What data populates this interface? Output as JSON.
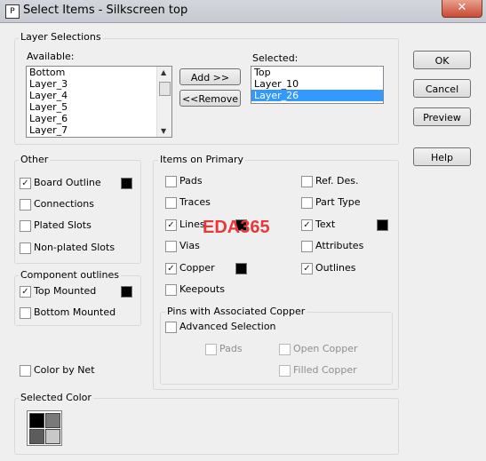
{
  "window": {
    "title": "Select Items - Silkscreen top",
    "close_glyph": "✕",
    "icon_glyph": "P"
  },
  "layer_selections": {
    "label": "Layer Selections",
    "available_label": "Available:",
    "available_items": [
      "Bottom",
      "Layer_3",
      "Layer_4",
      "Layer_5",
      "Layer_6",
      "Layer_7"
    ],
    "selected_label": "Selected:",
    "selected_items": [
      "Top",
      "Layer_10",
      "Layer_26"
    ],
    "selected_highlight_index": 2,
    "add_label": "Add >>",
    "remove_label": "<<Remove"
  },
  "buttons": {
    "ok": "OK",
    "cancel": "Cancel",
    "preview": "Preview",
    "help": "Help"
  },
  "other": {
    "label": "Other",
    "items": [
      {
        "label": "Board Outline",
        "checked": true,
        "color": "#000000"
      },
      {
        "label": "Connections",
        "checked": false
      },
      {
        "label": "Plated Slots",
        "checked": false
      },
      {
        "label": "Non-plated Slots",
        "checked": false
      }
    ]
  },
  "component_outlines": {
    "label": "Component outlines",
    "items": [
      {
        "label": "Top Mounted",
        "checked": true,
        "color": "#000000"
      },
      {
        "label": "Bottom Mounted",
        "checked": false
      }
    ]
  },
  "color_by_net": {
    "label": "Color by Net",
    "checked": false
  },
  "items_on_primary": {
    "label": "Items on Primary",
    "left": [
      {
        "label": "Pads",
        "checked": false
      },
      {
        "label": "Traces",
        "checked": false
      },
      {
        "label": "Lines",
        "checked": true,
        "color": "#000000"
      },
      {
        "label": "Vias",
        "checked": false
      },
      {
        "label": "Copper",
        "checked": true,
        "color": "#000000"
      },
      {
        "label": "Keepouts",
        "checked": false
      }
    ],
    "right": [
      {
        "label": "Ref. Des.",
        "checked": false
      },
      {
        "label": "Part Type",
        "checked": false
      },
      {
        "label": "Text",
        "checked": true,
        "color": "#000000"
      },
      {
        "label": "Attributes",
        "checked": false
      },
      {
        "label": "Outlines",
        "checked": true
      }
    ]
  },
  "pins": {
    "label": "Pins with Associated Copper",
    "advanced": {
      "label": "Advanced Selection",
      "checked": false
    },
    "pads": {
      "label": "Pads",
      "checked": false
    },
    "open_copper": {
      "label": "Open Copper",
      "checked": false
    },
    "filled_copper": {
      "label": "Filled Copper",
      "checked": false
    }
  },
  "selected_color": {
    "label": "Selected Color"
  },
  "watermark": "EDA365",
  "check_glyph": "✓"
}
